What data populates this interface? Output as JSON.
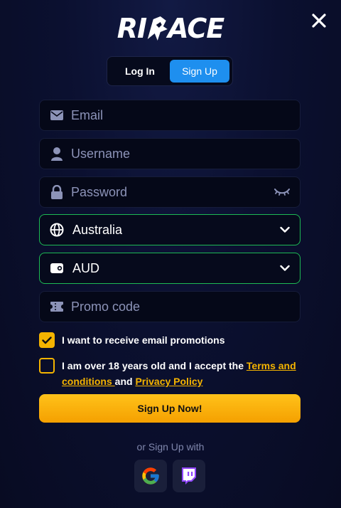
{
  "brand": {
    "logo_text_left": "RI",
    "logo_text_right": "ACE"
  },
  "tabs": {
    "login": "Log In",
    "signup": "Sign Up",
    "active": "signup"
  },
  "fields": {
    "email": {
      "placeholder": "Email",
      "icon": "envelope-icon"
    },
    "username": {
      "placeholder": "Username",
      "icon": "user-icon"
    },
    "password": {
      "placeholder": "Password",
      "icon": "lock-icon",
      "toggle_icon": "eye-closed-icon"
    },
    "country": {
      "value": "Australia",
      "icon": "globe-icon"
    },
    "currency": {
      "value": "AUD",
      "icon": "wallet-icon"
    },
    "promo": {
      "placeholder": "Promo code",
      "icon": "ticket-icon"
    }
  },
  "checkboxes": {
    "promotions": {
      "label": "I want to receive email promotions",
      "checked": true
    },
    "terms": {
      "prefix": "I am over 18 years old and I accept the ",
      "terms_link": "Terms and conditions ",
      "middle": "and ",
      "privacy_link": "Privacy Policy",
      "checked": false
    }
  },
  "submit_label": "Sign Up Now!",
  "social": {
    "prompt": "or Sign Up with",
    "providers": [
      "google-icon",
      "twitch-icon"
    ]
  },
  "colors": {
    "accent": "#f5b400",
    "tab_active": "#1e8fef",
    "select_border": "#1db954",
    "background": "#0b1030"
  }
}
